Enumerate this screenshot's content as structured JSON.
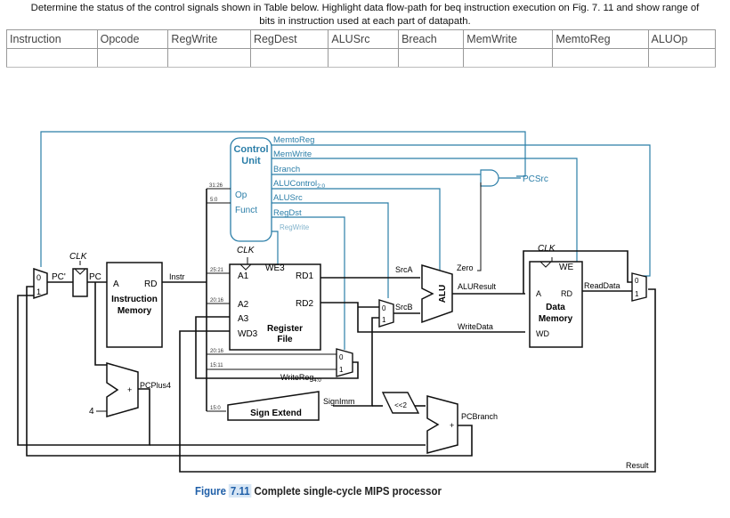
{
  "prompt": {
    "line1": "Determine the status of the control signals shown in Table below. Highlight data flow-path for beq instruction execution on Fig. 7. 11 and show range of",
    "line2": "bits in instruction used at each part of datapath."
  },
  "table": {
    "headers": [
      "Instruction",
      "Opcode",
      "RegWrite",
      "RegDest",
      "ALUSrc",
      "Breach",
      "MemWrite",
      "MemtoReg",
      "ALUOp"
    ],
    "rows": [
      [
        "",
        "",
        "",
        "",
        "",
        "",
        "",
        "",
        ""
      ]
    ]
  },
  "figure": {
    "control_unit": {
      "title1": "Control",
      "title2": "Unit",
      "op": "Op",
      "funct": "Funct"
    },
    "control_signals": [
      "MemtoReg",
      "MemWrite",
      "Branch",
      "ALUControl",
      "ALUSrc",
      "RegDst",
      "RegWrite"
    ],
    "alucontrol_sub": "2:0",
    "pcsrc": "PCSrc",
    "clk": "CLK",
    "pc_prime": "PC'",
    "pc": "PC",
    "imem": {
      "a": "A",
      "rd": "RD",
      "name1": "Instruction",
      "name2": "Memory"
    },
    "instr": "Instr",
    "bit_fields": {
      "op": "31:26",
      "funct": "5:0",
      "rs": "25:21",
      "rt": "20:16",
      "rt2": "20:16",
      "rd": "15:11",
      "imm": "15:0"
    },
    "regfile": {
      "we3": "WE3",
      "a1": "A1",
      "a2": "A2",
      "a3": "A3",
      "wd3": "WD3",
      "rd1": "RD1",
      "rd2": "RD2",
      "name1": "Register",
      "name2": "File"
    },
    "writereg": "WriteReg",
    "writereg_sub": "4:0",
    "srca": "SrcA",
    "srcb": "SrcB",
    "alu": "ALU",
    "zero": "Zero",
    "aluresult": "ALUResult",
    "writedata": "WriteData",
    "dmem": {
      "we": "WE",
      "a": "A",
      "rd": "RD",
      "name1": "Data",
      "name2": "Memory",
      "wd": "WD"
    },
    "readdata": "ReadData",
    "result": "Result",
    "sign_extend": "Sign Extend",
    "signimm": "SignImm",
    "shift": "<<2",
    "pcbranch": "PCBranch",
    "pcplus4": "PCPlus4",
    "four": "4",
    "plus": "+",
    "mux0": "0",
    "mux1": "1"
  },
  "caption": {
    "figure": "Figure",
    "number": "7.11",
    "text": "Complete single-cycle MIPS processor"
  },
  "colors": {
    "control": "#2b7ea8",
    "wire": "#111111",
    "caption_blue": "#1f5fa8"
  }
}
